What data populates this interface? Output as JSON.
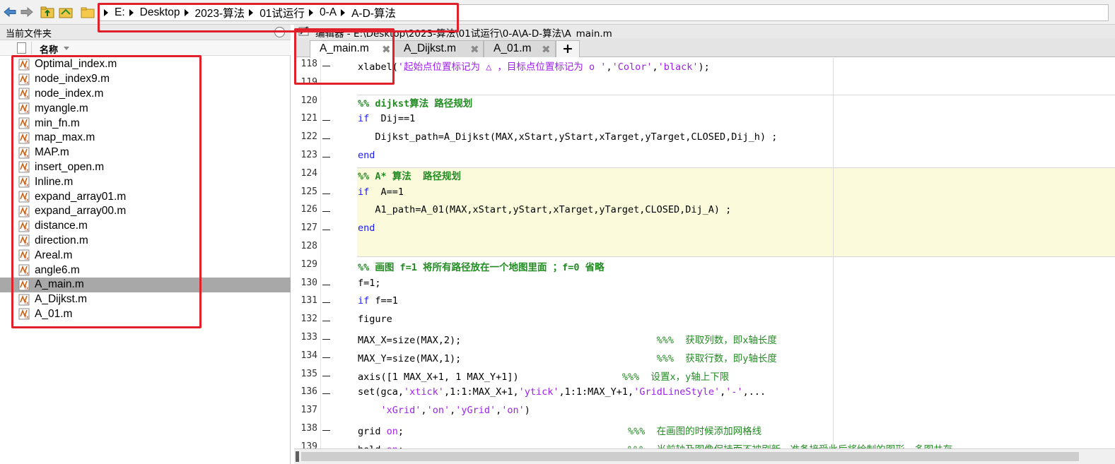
{
  "toolbar": {
    "breadcrumb": [
      "E:",
      "Desktop",
      "2023-算法",
      "01试运行",
      "0-A",
      "A-D-算法"
    ]
  },
  "left_panel": {
    "title": "当前文件夹",
    "column_name": "名称",
    "files": [
      "Optimal_index.m",
      "node_index9.m",
      "node_index.m",
      "myangle.m",
      "min_fn.m",
      "map_max.m",
      "MAP.m",
      "insert_open.m",
      "Inline.m",
      "expand_array01.m",
      "expand_array00.m",
      "distance.m",
      "direction.m",
      "Areal.m",
      "angle6.m",
      "A_main.m",
      "A_Dijkst.m",
      "A_01.m"
    ],
    "selected": "A_main.m"
  },
  "editor": {
    "title": "编辑器 - E:\\Desktop\\2023-算法\\01试运行\\0-A\\A-D-算法\\A_main.m",
    "tabs": [
      {
        "label": "A_main.m",
        "active": true
      },
      {
        "label": "A_Dijkst.m",
        "active": false
      },
      {
        "label": "A_01.m",
        "active": false
      }
    ],
    "add_tab_label": "+",
    "close_glyph": "✖"
  },
  "code": {
    "lines": [
      {
        "n": "118",
        "dash": true,
        "segs": [
          [
            "",
            "xlabel("
          ],
          [
            "str",
            "'起始点位置标记为 △ ，目标点位置标记为 o '"
          ],
          [
            "",
            ","
          ],
          [
            "str",
            "'Color'"
          ],
          [
            "",
            ","
          ],
          [
            "str",
            "'black'"
          ],
          [
            "",
            ");"
          ]
        ]
      },
      {
        "n": "119",
        "dash": false,
        "segs": []
      },
      {
        "n": "120",
        "dash": false,
        "segs": [
          [
            "cellh",
            "%% dijkst算法 路径规划"
          ]
        ]
      },
      {
        "n": "121",
        "dash": true,
        "segs": [
          [
            "kw",
            "if"
          ],
          [
            "",
            "  Dij==1"
          ]
        ]
      },
      {
        "n": "122",
        "dash": true,
        "segs": [
          [
            "",
            "   Dijkst_path=A_Dijkst(MAX,xStart,yStart,xTarget,yTarget,CLOSED,Dij_h) ;"
          ]
        ]
      },
      {
        "n": "123",
        "dash": true,
        "segs": [
          [
            "kw",
            "end"
          ]
        ]
      },
      {
        "n": "124",
        "dash": false,
        "segs": [
          [
            "cellh",
            "%% A* 算法  路径规划"
          ]
        ]
      },
      {
        "n": "125",
        "dash": true,
        "segs": [
          [
            "kw",
            "if"
          ],
          [
            "",
            "  A==1"
          ]
        ]
      },
      {
        "n": "126",
        "dash": true,
        "segs": [
          [
            "",
            "   A1_path=A_01(MAX,xStart,yStart,xTarget,yTarget,CLOSED,Dij_A) ;"
          ]
        ]
      },
      {
        "n": "127",
        "dash": true,
        "segs": [
          [
            "kw",
            "end"
          ]
        ]
      },
      {
        "n": "128",
        "dash": false,
        "segs": []
      },
      {
        "n": "129",
        "dash": false,
        "segs": [
          [
            "cellh",
            "%% 画图 f=1 将所有路径放在一个地图里面 ；f=0 省略"
          ]
        ]
      },
      {
        "n": "130",
        "dash": true,
        "segs": [
          [
            "",
            "f=1;"
          ]
        ]
      },
      {
        "n": "131",
        "dash": true,
        "segs": [
          [
            "kw",
            "if"
          ],
          [
            "",
            " f==1"
          ]
        ]
      },
      {
        "n": "132",
        "dash": true,
        "segs": [
          [
            "",
            "figure"
          ]
        ]
      },
      {
        "n": "133",
        "dash": true,
        "segs": [
          [
            "",
            "MAX_X=size(MAX,2);                                  "
          ],
          [
            "cmt",
            "%%%  获取列数，即x轴长度"
          ]
        ]
      },
      {
        "n": "134",
        "dash": true,
        "segs": [
          [
            "",
            "MAX_Y=size(MAX,1);                                  "
          ],
          [
            "cmt",
            "%%%  获取行数，即y轴长度"
          ]
        ]
      },
      {
        "n": "135",
        "dash": true,
        "segs": [
          [
            "",
            "axis([1 MAX_X+1, 1 MAX_Y+1])                  "
          ],
          [
            "cmt",
            "%%%  设置x，y轴上下限"
          ]
        ]
      },
      {
        "n": "136",
        "dash": true,
        "segs": [
          [
            "",
            "set(gca,"
          ],
          [
            "str",
            "'xtick'"
          ],
          [
            "",
            ",1:1:MAX_X+1,"
          ],
          [
            "str",
            "'ytick'"
          ],
          [
            "",
            ",1:1:MAX_Y+1,"
          ],
          [
            "str",
            "'GridLineStyle'"
          ],
          [
            "",
            ","
          ],
          [
            "str",
            "'-'"
          ],
          [
            "",
            ",..."
          ]
        ]
      },
      {
        "n": "137",
        "dash": false,
        "segs": [
          [
            "",
            "    "
          ],
          [
            "str",
            "'xGrid'"
          ],
          [
            "",
            ","
          ],
          [
            "str",
            "'on'"
          ],
          [
            "",
            ","
          ],
          [
            "str",
            "'yGrid'"
          ],
          [
            "",
            ","
          ],
          [
            "str",
            "'on'"
          ],
          [
            "",
            ")"
          ]
        ]
      },
      {
        "n": "138",
        "dash": true,
        "segs": [
          [
            "",
            "grid "
          ],
          [
            "str",
            "on"
          ],
          [
            "",
            ";                                       "
          ],
          [
            "cmt",
            "%%%  在画图的时候添加网格线"
          ]
        ]
      },
      {
        "n": "139",
        "dash": true,
        "segs": [
          [
            "",
            "hold "
          ],
          [
            "str",
            "on"
          ],
          [
            "",
            ";                                       "
          ],
          [
            "cmt",
            "%%%  当前轴及图像保持而不被刷新，准备接受此后将绘制的图形，多图共存"
          ]
        ]
      }
    ]
  }
}
